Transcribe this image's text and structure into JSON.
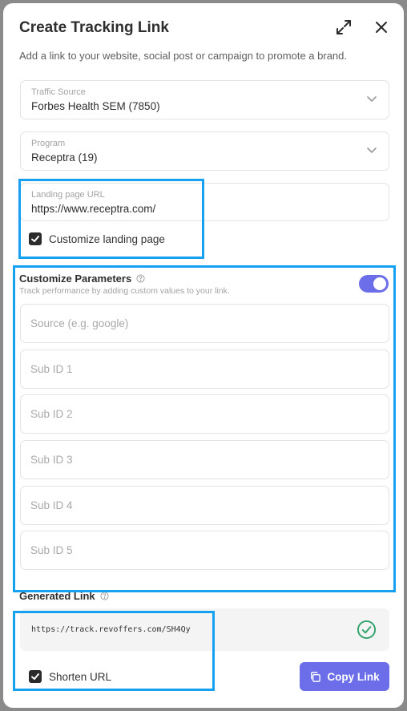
{
  "modal": {
    "title": "Create Tracking Link",
    "subtitle": "Add a link to your website, social post or campaign to promote a brand."
  },
  "traffic_source": {
    "label": "Traffic Source",
    "value": "Forbes Health SEM (7850)"
  },
  "program": {
    "label": "Program",
    "value": "Receptra (19)"
  },
  "landing_page": {
    "label": "Landing page URL",
    "value": "https://www.receptra.com/",
    "customize_label": "Customize landing page",
    "customize_checked": true
  },
  "parameters": {
    "title": "Customize Parameters",
    "description": "Track performance by adding custom values to your link.",
    "toggle_on": true,
    "placeholders": [
      "Source (e.g. google)",
      "Sub ID 1",
      "Sub ID 2",
      "Sub ID 3",
      "Sub ID 4",
      "Sub ID 5"
    ]
  },
  "generated": {
    "title": "Generated Link",
    "link": "https://track.revoffers.com/SH4Qy",
    "shorten_label": "Shorten URL",
    "shorten_checked": true,
    "copy_label": "Copy Link"
  },
  "colors": {
    "accent": "#6b6ee8",
    "highlight": "#16a0f0",
    "success": "#2fa36b"
  },
  "icons": [
    "expand-icon",
    "close-icon",
    "chevron-down-icon",
    "checkmark-icon",
    "help-circle-icon",
    "check-circle-icon",
    "copy-icon"
  ]
}
